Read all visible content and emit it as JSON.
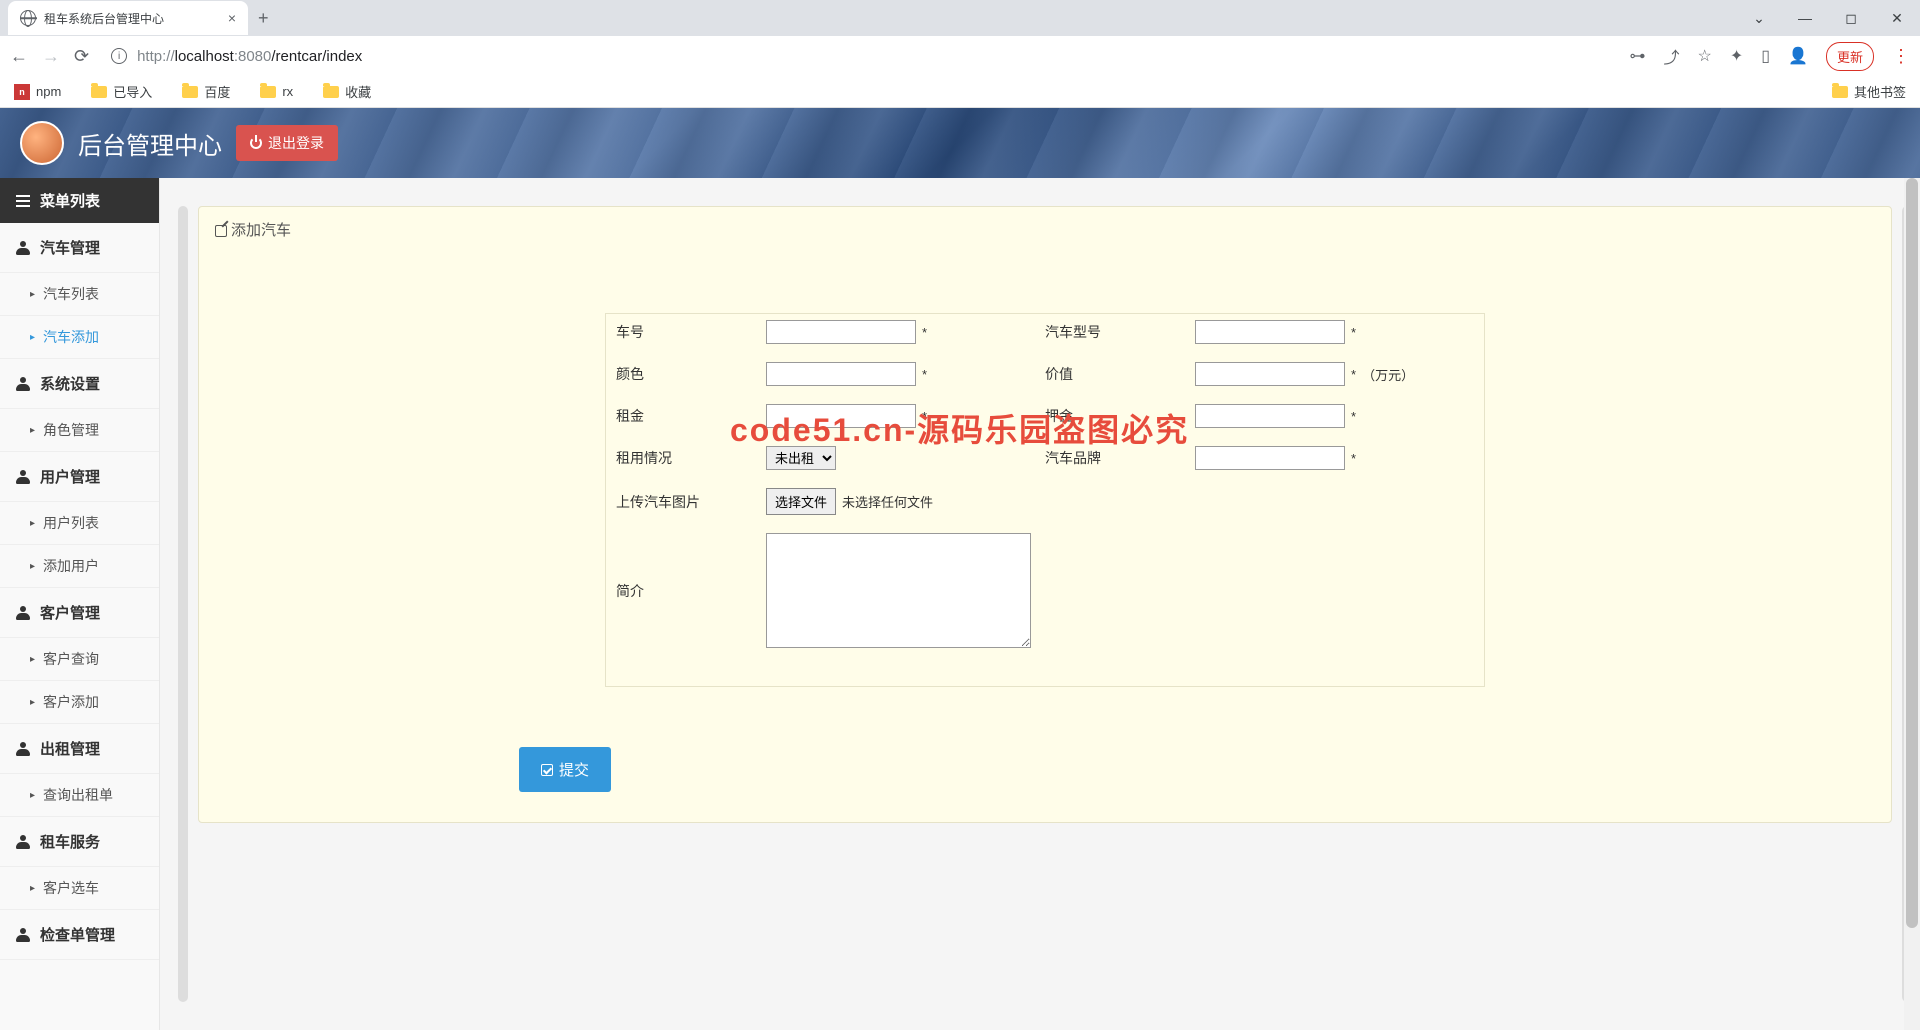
{
  "browser": {
    "tab_title": "租车系统后台管理中心",
    "url_prefix": "http://",
    "url_host": "localhost",
    "url_port": ":8080",
    "url_path": "/rentcar/index",
    "update_label": "更新"
  },
  "bookmarks": {
    "items": [
      "npm",
      "已导入",
      "百度",
      "rx",
      "收藏"
    ],
    "other": "其他书签"
  },
  "header": {
    "title": "后台管理中心",
    "logout": "退出登录"
  },
  "sidebar": {
    "menu_header": "菜单列表",
    "groups": [
      {
        "label": "汽车管理",
        "subs": [
          "汽车列表",
          "汽车添加"
        ]
      },
      {
        "label": "系统设置",
        "subs": [
          "角色管理"
        ]
      },
      {
        "label": "用户管理",
        "subs": [
          "用户列表",
          "添加用户"
        ]
      },
      {
        "label": "客户管理",
        "subs": [
          "客户查询",
          "客户添加"
        ]
      },
      {
        "label": "出租管理",
        "subs": [
          "查询出租单"
        ]
      },
      {
        "label": "租车服务",
        "subs": [
          "客户选车"
        ]
      },
      {
        "label": "检查单管理",
        "subs": []
      }
    ],
    "active_sub": "汽车添加"
  },
  "panel": {
    "title": "添加汽车"
  },
  "form": {
    "car_no": "车号",
    "car_model": "汽车型号",
    "color": "颜色",
    "value": "价值",
    "value_unit": "（万元）",
    "rent": "租金",
    "deposit": "押金",
    "rent_status": "租用情况",
    "rent_status_option": "未出租",
    "brand": "汽车品牌",
    "upload": "上传汽车图片",
    "choose_file": "选择文件",
    "no_file": "未选择任何文件",
    "intro": "简介",
    "required": "*",
    "submit": "提交"
  },
  "watermark": "code51.cn-源码乐园盗图必究"
}
